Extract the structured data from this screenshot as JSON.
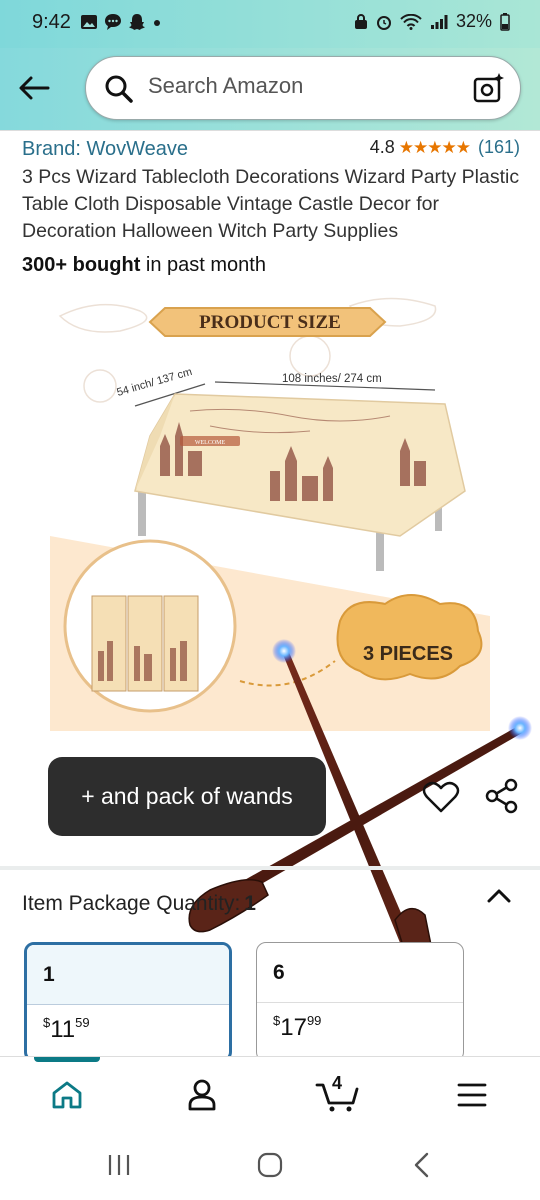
{
  "status_bar": {
    "time": "9:42",
    "battery": "32%",
    "left_icons": [
      "gallery-icon",
      "chat-icon",
      "snapchat-icon",
      "dot-icon"
    ],
    "right_icons": [
      "lock-icon",
      "alarm-icon",
      "wifi-icon",
      "signal-icon",
      "battery-icon"
    ]
  },
  "header": {
    "search_placeholder": "Search Amazon"
  },
  "product": {
    "brand": "Brand: WovWeave",
    "rating": "4.8",
    "stars": "★★★★★",
    "review_count": "(161)",
    "title": "3 Pcs Wizard Tablecloth Decorations Wizard Party Plastic Table Cloth Disposable Vintage Castle Decor for Decoration Halloween Witch Party Supplies",
    "bought_bold": "300+ bought",
    "bought_rest": " in past month"
  },
  "image": {
    "banner": "PRODUCT SIZE",
    "width_label": "54 inch/ 137 cm",
    "length_label": "108 inches/ 274 cm",
    "pieces_label": "3 PIECES",
    "welcome_text": "WELCOME"
  },
  "toast": {
    "text": "+ and pack of wands"
  },
  "quantity": {
    "label": "Item Package Quantity:",
    "value": "1",
    "options": [
      {
        "qty": "1",
        "currency": "$",
        "whole": "11",
        "cents": "59"
      },
      {
        "qty": "6",
        "currency": "$",
        "whole": "17",
        "cents": "99"
      }
    ]
  },
  "bottom_nav": {
    "cart_count": "4",
    "items": [
      "home-icon",
      "profile-icon",
      "cart-icon",
      "menu-icon"
    ]
  },
  "colors": {
    "brand_link": "#2a6f8b",
    "star": "#e77600",
    "selected_border": "#2d6fa3",
    "nav_accent": "#0c7a86"
  }
}
